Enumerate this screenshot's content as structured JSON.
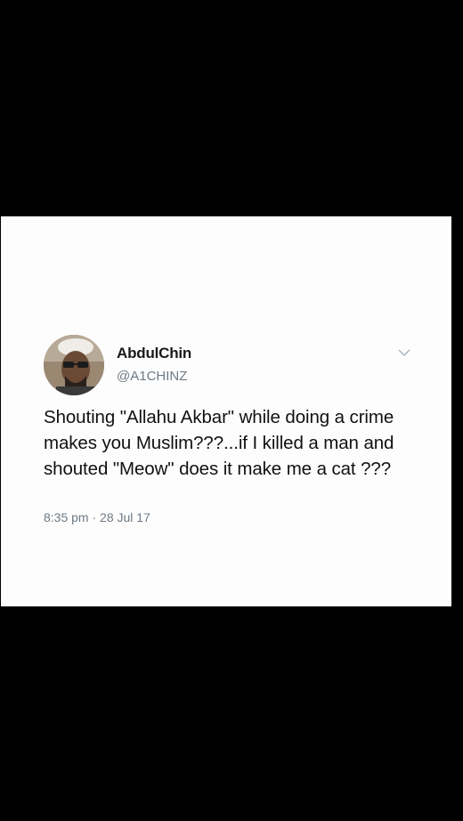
{
  "tweet": {
    "display_name": "AbdulChin",
    "handle": "@A1CHINZ",
    "text": "Shouting \"Allahu Akbar\" while doing a crime makes you Muslim???...if I killed a man and shouted \"Meow\" does it make me a cat ???",
    "timestamp": "8:35 pm · 28 Jul 17"
  },
  "icons": {
    "avatar": "profile-photo",
    "menu": "chevron-down-icon"
  },
  "colors": {
    "background": "#000000",
    "card": "#fdfdfd",
    "text": "#111111",
    "secondary_text": "#6f7a84"
  }
}
